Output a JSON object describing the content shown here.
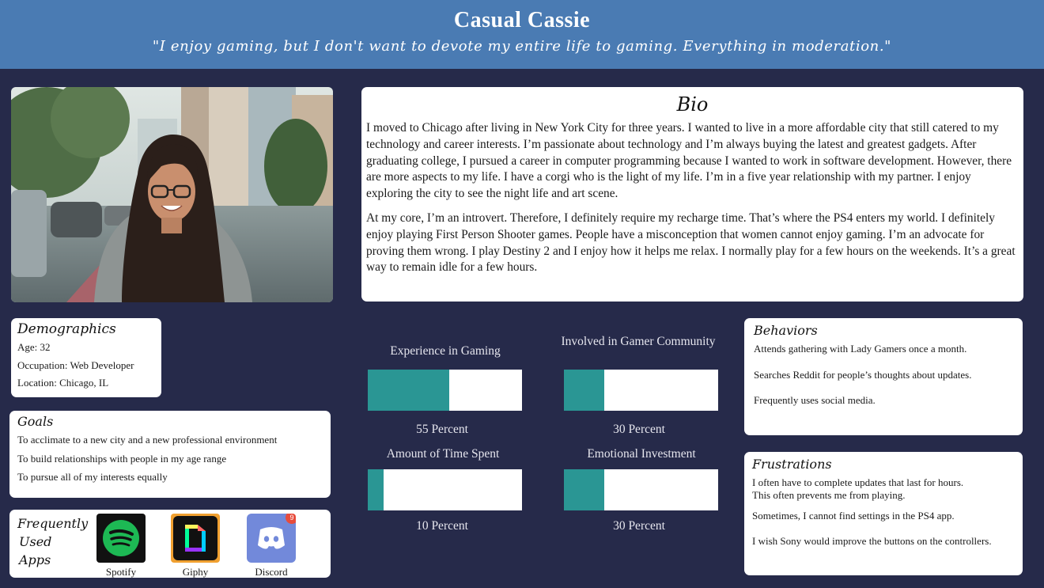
{
  "header": {
    "name": "Casual Cassie",
    "quote": "\"I enjoy gaming, but I don't want to devote my entire life to gaming. Everything in moderation.\""
  },
  "bio": {
    "title": "Bio",
    "paragraphs": [
      "I moved to Chicago after living in New York City for three years. I wanted to live in a more affordable city that still catered to my technology and career interests. I’m passionate about technology and I’m always buying the latest and greatest gadgets. After graduating college, I pursued a career in computer programming because I wanted to work in software development. However, there are more aspects to my life. I have a corgi who is the light of my life. I’m in a five year relationship with my partner. I enjoy exploring the city to see the night life and art scene.",
      "At my core, I’m an introvert. Therefore, I definitely require my recharge time. That’s where the PS4 enters my world. I definitely enjoy playing First Person Shooter games. People have a misconception that women cannot enjoy gaming. I’m an advocate for proving them wrong. I play Destiny 2 and I enjoy how it helps me relax. I normally play for a few hours on the weekends. It’s a great way to remain idle for a few hours."
    ]
  },
  "demographics": {
    "title": "Demographics",
    "rows": [
      "Age: 32",
      "Occupation:  Web Developer",
      "Location: Chicago, IL"
    ]
  },
  "goals": {
    "title": "Goals",
    "rows": [
      "To acclimate to a new city and a new professional environment",
      "To build relationships with people in my age range",
      "To pursue all of my interests equally"
    ]
  },
  "apps": {
    "title_lines": [
      "Frequently",
      "Used",
      "Apps"
    ],
    "items": [
      {
        "name": "Spotify",
        "icon": "spotify-icon"
      },
      {
        "name": "Giphy",
        "icon": "giphy-icon"
      },
      {
        "name": "Discord",
        "icon": "discord-icon",
        "badge": "9"
      }
    ]
  },
  "meters": [
    {
      "title": "Experience in Gaming",
      "value_label": "55 Percent",
      "value": 0.53
    },
    {
      "title": "Involved in Gamer Community",
      "value_label": "30 Percent",
      "value": 0.26
    },
    {
      "title": "Amount of Time Spent",
      "value_label": "10 Percent",
      "value": 0.1
    },
    {
      "title": "Emotional Investment",
      "value_label": "30 Percent",
      "value": 0.26
    }
  ],
  "behaviors": {
    "title": "Behaviors",
    "rows": [
      "Attends gathering with Lady Gamers once a month.",
      "Searches Reddit for people’s thoughts about updates.",
      "Frequently uses social media."
    ]
  },
  "frustrations": {
    "title": "Frustrations",
    "rows": [
      "I often have to complete updates that last for hours.\nThis often prevents me from playing.",
      "Sometimes, I cannot find settings in the PS4 app.",
      "I wish Sony would improve the buttons on the controllers."
    ]
  },
  "colors": {
    "header_bg": "#4a7bb3",
    "page_bg": "#262a4a",
    "meter_fill": "#2a9694"
  }
}
